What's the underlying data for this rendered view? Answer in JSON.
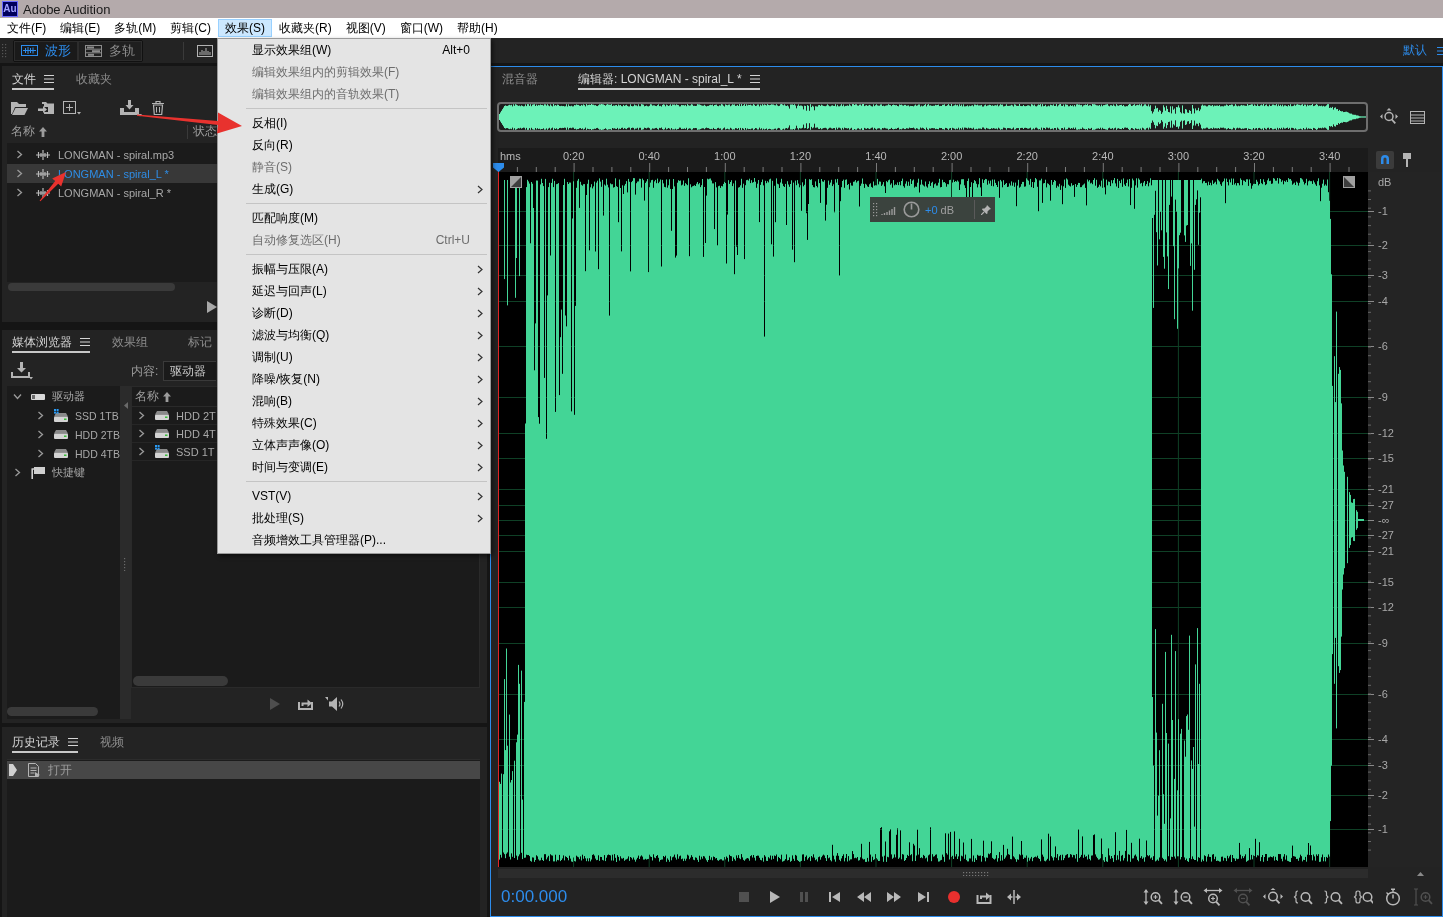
{
  "window": {
    "logo": "Au",
    "title": "Adobe Audition"
  },
  "menubar": [
    {
      "label": "文件(F)",
      "selected": false
    },
    {
      "label": "编辑(E)",
      "selected": false
    },
    {
      "label": "多轨(M)",
      "selected": false
    },
    {
      "label": "剪辑(C)",
      "selected": false
    },
    {
      "label": "效果(S)",
      "selected": true
    },
    {
      "label": "收藏夹(R)",
      "selected": false
    },
    {
      "label": "视图(V)",
      "selected": false
    },
    {
      "label": "窗口(W)",
      "selected": false
    },
    {
      "label": "帮助(H)",
      "selected": false
    }
  ],
  "toolbar": {
    "modes": [
      {
        "kind": "waveform",
        "label": "波形",
        "selected": true
      },
      {
        "kind": "multitrack",
        "label": "多轨",
        "selected": false
      }
    ],
    "workspace": "默认"
  },
  "files_panel": {
    "tabs": [
      {
        "label": "文件",
        "selected": true
      },
      {
        "label": "收藏夹",
        "selected": false
      }
    ],
    "columns": [
      "名称",
      "状态"
    ],
    "rows": [
      {
        "name": "LONGMAN - spiral.mp3",
        "selected": false,
        "expanded": false
      },
      {
        "name": "LONGMAN - spiral_L *",
        "selected": true,
        "expanded": false
      },
      {
        "name": "LONGMAN - spiral_R *",
        "selected": false,
        "expanded": false
      }
    ],
    "preview_controls": [
      {
        "kind": "play",
        "disabled": false
      }
    ]
  },
  "media_panel": {
    "tabs": [
      {
        "label": "媒体浏览器",
        "selected": true
      },
      {
        "label": "效果组",
        "selected": false
      },
      {
        "label": "标记",
        "selected": false
      }
    ],
    "content_label": "内容:",
    "content_value": "驱动器",
    "tree": [
      {
        "label": "驱动器",
        "kind": "drives",
        "expanded": true,
        "children": [
          {
            "label": "SSD 1TB",
            "kind": "system-drive",
            "expanded": false
          },
          {
            "label": "HDD 2TB",
            "kind": "drive",
            "expanded": false
          },
          {
            "label": "HDD 4TB",
            "kind": "drive",
            "expanded": false
          }
        ]
      },
      {
        "label": "快捷键",
        "kind": "shortcuts",
        "expanded": false
      }
    ],
    "list_columns": [
      "名称"
    ],
    "list": [
      {
        "name": "HDD 2T",
        "kind": "drive",
        "expanded": false
      },
      {
        "name": "HDD 4T",
        "kind": "drive",
        "expanded": false
      },
      {
        "name": "SSD 1T",
        "kind": "system-drive",
        "expanded": false
      }
    ],
    "preview_controls": [
      {
        "kind": "play",
        "disabled": true
      },
      {
        "kind": "loop",
        "disabled": false
      },
      {
        "kind": "volume",
        "disabled": false
      }
    ]
  },
  "history_panel": {
    "tabs": [
      {
        "label": "历史记录",
        "selected": true
      },
      {
        "label": "视频",
        "selected": false
      }
    ],
    "items": [
      {
        "label": "打开",
        "selected": true
      }
    ]
  },
  "editor": {
    "tabs": [
      {
        "label": "混音器",
        "selected": false
      },
      {
        "label": "编辑器: LONGMAN - spiral_L *",
        "selected": true
      }
    ],
    "snapping": true,
    "ruler": [
      "hms",
      "0:20",
      "0:40",
      "1:00",
      "1:20",
      "1:40",
      "2:00",
      "2:20",
      "2:40",
      "3:00",
      "3:20",
      "3:40"
    ],
    "amplitude_scale": [
      "dB",
      "-1",
      "-2",
      "-3",
      "-4",
      "-6",
      "-9",
      "-12",
      "-15",
      "-21",
      "-27",
      "-∞",
      "-27",
      "-21",
      "-15",
      "-12",
      "-9",
      "-6",
      "-4",
      "-3",
      "-2",
      "-1"
    ],
    "gain": {
      "value": "+0",
      "unit": "dB"
    },
    "time": "0:00.000",
    "transport": [
      {
        "kind": "stop",
        "disabled": true
      },
      {
        "kind": "play",
        "disabled": false
      },
      {
        "kind": "pause",
        "disabled": true
      },
      {
        "kind": "skip-to-start",
        "disabled": false
      },
      {
        "kind": "rewind",
        "disabled": false
      },
      {
        "kind": "fast-forward",
        "disabled": false
      },
      {
        "kind": "skip-to-end",
        "disabled": false
      },
      {
        "kind": "record",
        "disabled": false
      },
      {
        "kind": "loop",
        "disabled": false
      },
      {
        "kind": "skip-selection",
        "disabled": false
      }
    ],
    "zoom_tools": [
      {
        "kind": "zoom-in-amplitude",
        "disabled": false
      },
      {
        "kind": "zoom-out-amplitude",
        "disabled": false
      },
      {
        "kind": "zoom-in-time",
        "disabled": false
      },
      {
        "kind": "zoom-out-time",
        "disabled": true
      },
      {
        "kind": "zoom-full",
        "disabled": false
      },
      {
        "kind": "zoom-in-point",
        "disabled": false
      },
      {
        "kind": "zoom-out-point",
        "disabled": false
      },
      {
        "kind": "zoom-selection",
        "disabled": false
      },
      {
        "kind": "stopwatch",
        "disabled": false
      },
      {
        "kind": "ibeam-zoom",
        "disabled": true
      }
    ]
  },
  "effects_menu": {
    "groups": [
      [
        {
          "label": "显示效果组(W)",
          "shortcut": "Alt+0",
          "disabled": false,
          "submenu": false
        },
        {
          "label": "编辑效果组内的剪辑效果(F)",
          "disabled": true,
          "submenu": false
        },
        {
          "label": "编辑效果组内的音轨效果(T)",
          "disabled": true,
          "submenu": false
        }
      ],
      [
        {
          "label": "反相(I)",
          "disabled": false,
          "submenu": false
        },
        {
          "label": "反向(R)",
          "disabled": false,
          "submenu": false
        },
        {
          "label": "静音(S)",
          "disabled": true,
          "submenu": false
        },
        {
          "label": "生成(G)",
          "disabled": false,
          "submenu": true
        }
      ],
      [
        {
          "label": "匹配响度(M)",
          "disabled": false,
          "submenu": false
        },
        {
          "label": "自动修复选区(H)",
          "shortcut": "Ctrl+U",
          "disabled": true,
          "submenu": false
        }
      ],
      [
        {
          "label": "振幅与压限(A)",
          "disabled": false,
          "submenu": true
        },
        {
          "label": "延迟与回声(L)",
          "disabled": false,
          "submenu": true
        },
        {
          "label": "诊断(D)",
          "disabled": false,
          "submenu": true
        },
        {
          "label": "滤波与均衡(Q)",
          "disabled": false,
          "submenu": true
        },
        {
          "label": "调制(U)",
          "disabled": false,
          "submenu": true
        },
        {
          "label": "降噪/恢复(N)",
          "disabled": false,
          "submenu": true
        },
        {
          "label": "混响(B)",
          "disabled": false,
          "submenu": true
        },
        {
          "label": "特殊效果(C)",
          "disabled": false,
          "submenu": true
        },
        {
          "label": "立体声声像(O)",
          "disabled": false,
          "submenu": true
        },
        {
          "label": "时间与变调(E)",
          "disabled": false,
          "submenu": true
        }
      ],
      [
        {
          "label": "VST(V)",
          "disabled": false,
          "submenu": true
        },
        {
          "label": "批处理(S)",
          "disabled": false,
          "submenu": true
        },
        {
          "label": "音频增效工具管理器(P)...",
          "disabled": false,
          "submenu": false
        }
      ]
    ]
  }
}
